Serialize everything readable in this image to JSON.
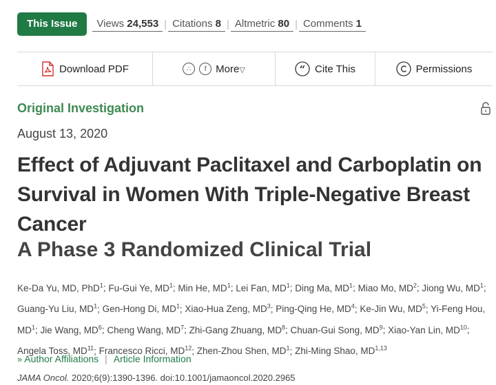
{
  "header": {
    "issue_button": "This Issue",
    "metrics": [
      {
        "label": "Views",
        "value": "24,553"
      },
      {
        "label": "Citations",
        "value": "8"
      },
      {
        "label": "Altmetric",
        "value": "80"
      },
      {
        "label": "Comments",
        "value": "1"
      }
    ]
  },
  "actions": {
    "download": "Download PDF",
    "more": "More",
    "cite": "Cite This",
    "permissions": "Permissions",
    "twitter_glyph": "∴",
    "facebook_glyph": "f",
    "more_caret": "▽"
  },
  "article": {
    "type": "Original Investigation",
    "date": "August 13, 2020",
    "title": "Effect of Adjuvant Paclitaxel and Carboplatin on Survival in Women With Triple-Negative Breast Cancer",
    "subtitle": "A Phase 3 Randomized Clinical Trial",
    "authors": [
      {
        "name": "Ke-Da Yu, MD, PhD",
        "sup": "1"
      },
      {
        "name": "Fu-Gui Ye, MD",
        "sup": "1"
      },
      {
        "name": "Min He, MD",
        "sup": "1"
      },
      {
        "name": "Lei Fan, MD",
        "sup": "1"
      },
      {
        "name": "Ding Ma, MD",
        "sup": "1"
      },
      {
        "name": "Miao Mo, MD",
        "sup": "2"
      },
      {
        "name": "Jiong Wu, MD",
        "sup": "1"
      },
      {
        "name": "Guang-Yu Liu, MD",
        "sup": "1"
      },
      {
        "name": "Gen-Hong Di, MD",
        "sup": "1"
      },
      {
        "name": "Xiao-Hua Zeng, MD",
        "sup": "3"
      },
      {
        "name": "Ping-Qing He, MD",
        "sup": "4"
      },
      {
        "name": "Ke-Jin Wu, MD",
        "sup": "5"
      },
      {
        "name": "Yi-Feng Hou, MD",
        "sup": "1"
      },
      {
        "name": "Jie Wang, MD",
        "sup": "6"
      },
      {
        "name": "Cheng Wang, MD",
        "sup": "7"
      },
      {
        "name": "Zhi-Gang Zhuang, MD",
        "sup": "8"
      },
      {
        "name": "Chuan-Gui Song, MD",
        "sup": "9"
      },
      {
        "name": "Xiao-Yan Lin, MD",
        "sup": "10"
      },
      {
        "name": "Angela Toss, MD",
        "sup": "11"
      },
      {
        "name": "Francesco Ricci, MD",
        "sup": "12"
      },
      {
        "name": "Zhen-Zhou Shen, MD",
        "sup": "1"
      },
      {
        "name": "Zhi-Ming Shao, MD",
        "sup": "1,13"
      }
    ],
    "author_affiliations": "Author Affiliations",
    "article_information": "Article Information",
    "chevron_glyph": "»",
    "link_separator": "|",
    "journal": "JAMA Oncol.",
    "citation_rest": "2020;6(9):1390-1396. doi:10.1001/jamaoncol.2020.2965"
  },
  "colors": {
    "accent_green": "#1f7a44",
    "section_green": "#3d8a52",
    "pdf_red": "#d0312d"
  },
  "icons": [
    "pdf-icon",
    "twitter-icon",
    "facebook-icon",
    "quote-icon",
    "copyright-icon",
    "lock-icon"
  ]
}
